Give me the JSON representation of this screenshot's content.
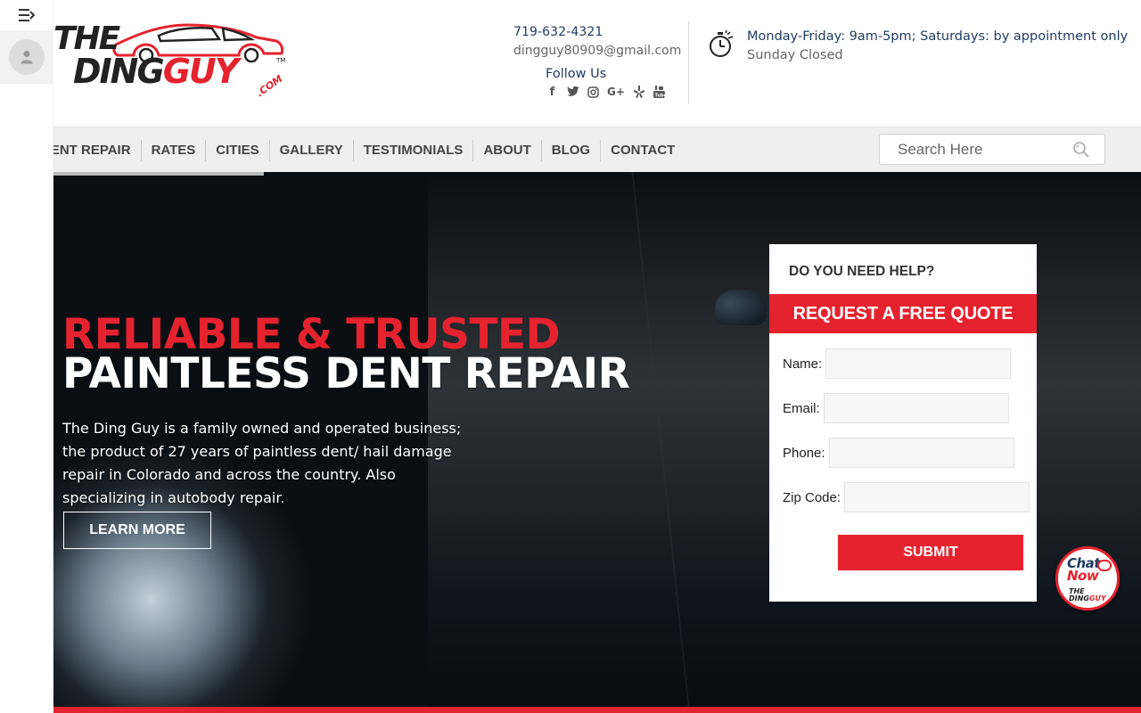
{
  "brand": {
    "logo_line1": "THE",
    "logo_line2_a": "DING",
    "logo_line2_b": "GUY",
    "logo_suffix": ".COM",
    "colors": {
      "accent": "#e5232e",
      "navy": "#1e3a5f",
      "dark": "#222222"
    }
  },
  "contact": {
    "phone": "719-632-4321",
    "email": "dingguy80909@gmail.com",
    "follow_label": "Follow Us",
    "social_icons": [
      "facebook-icon",
      "twitter-icon",
      "instagram-icon",
      "google-plus-icon",
      "yelp-icon",
      "youtube-icon"
    ]
  },
  "hours": {
    "line1": "Monday-Friday: 9am-5pm; Saturdays: by appointment only",
    "line2": "Sunday Closed"
  },
  "nav": {
    "items": [
      "DENT REPAIR",
      "RATES",
      "CITIES",
      "GALLERY",
      "TESTIMONIALS",
      "ABOUT",
      "BLOG",
      "CONTACT"
    ],
    "search_placeholder": "Search Here"
  },
  "hero": {
    "headline_red": "RELIABLE & TRUSTED",
    "headline_white": "PAINTLESS DENT REPAIR",
    "body": "The Ding Guy is a family owned and operated business; the product of 27 years of paintless dent/ hail damage repair in Colorado and across the country. Also specializing in autobody repair.",
    "cta": "LEARN MORE"
  },
  "quote_form": {
    "help_text": "DO YOU NEED HELP?",
    "banner": "REQUEST A FREE QUOTE",
    "fields": [
      {
        "label": "Name:",
        "value": ""
      },
      {
        "label": "Email:",
        "value": ""
      },
      {
        "label": "Phone:",
        "value": ""
      },
      {
        "label": "Zip Code:",
        "value": ""
      }
    ],
    "submit": "SUBMIT"
  },
  "chat": {
    "line1": "Chat",
    "line2": "Now",
    "logo_a": "THE",
    "logo_b": "DING",
    "logo_c": "GUY"
  }
}
